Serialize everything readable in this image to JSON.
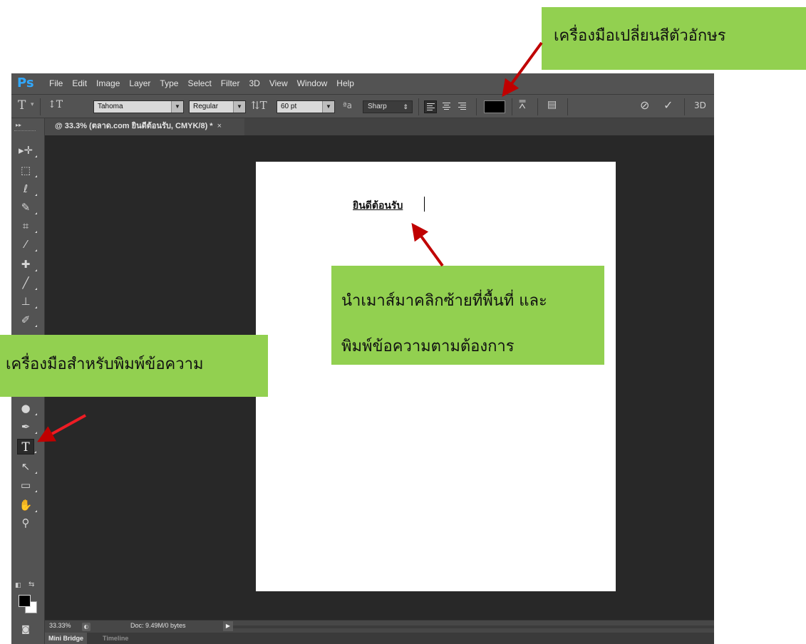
{
  "app": {
    "logo": "Ps",
    "menu": [
      "File",
      "Edit",
      "Image",
      "Layer",
      "Type",
      "Select",
      "Filter",
      "3D",
      "View",
      "Window",
      "Help"
    ]
  },
  "options_bar": {
    "font_family": "Tahoma",
    "font_style": "Regular",
    "font_size": "60 pt",
    "antialias_label": "ªa",
    "antialias": "Sharp",
    "text_color": "#000000",
    "label_3d": "3D"
  },
  "document": {
    "tab_title": "@ 33.3% (ตลาด.com ยินดีต้อนรับ, CMYK/8) *",
    "close_symbol": "×",
    "canvas_text": "ยินดีต้อนรับ"
  },
  "status": {
    "zoom": "33.33%",
    "doc_info": "Doc: 9.49M/0 bytes"
  },
  "panels": {
    "tabs": [
      "Mini Bridge",
      "Timeline"
    ]
  },
  "callouts": {
    "color_tool": "เครื่องมือเปลี่ยนสีตัวอักษร",
    "click_line1": "นำเมาส์มาคลิกซ้ายที่พื้นที่ และ",
    "click_line2": "พิมพ์ข้อความตามต้องการ",
    "type_tool": "เครื่องมือสำหรับพิมพ์ข้อความ"
  },
  "colors": {
    "callout_bg": "#92d050",
    "arrow": "#c00000",
    "ps_logo": "#31a8ff",
    "chrome": "#535353",
    "workspace": "#282828"
  }
}
